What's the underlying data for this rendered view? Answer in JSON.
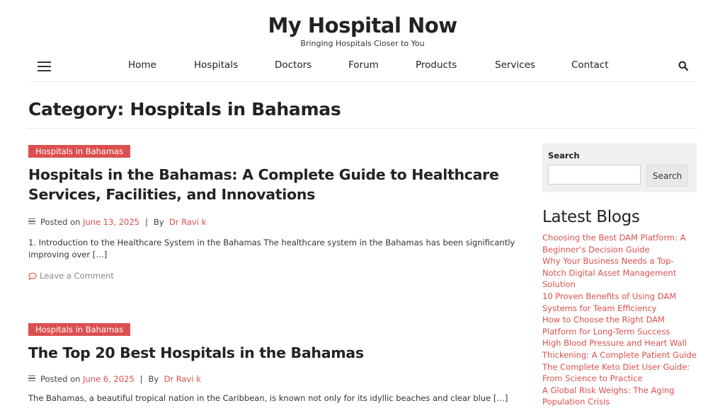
{
  "site": {
    "title": "My Hospital Now",
    "tagline": "Bringing Hospitals Closer to You"
  },
  "nav": {
    "items": [
      "Home",
      "Hospitals",
      "Doctors",
      "Forum",
      "Products",
      "Services",
      "Contact"
    ]
  },
  "page": {
    "title": "Category: Hospitals in Bahamas"
  },
  "posts": [
    {
      "category": "Hospitals in Bahamas",
      "title": "Hospitals in the Bahamas: A Complete Guide to Healthcare Services, Facilities, and Innovations",
      "posted_on": "Posted on",
      "date": "June 13, 2025",
      "by": "By",
      "author": "Dr Ravi k",
      "excerpt": "1. Introduction to the Healthcare System in the Bahamas The healthcare system in the Bahamas has been significantly improving over […]",
      "comment": "Leave a Comment"
    },
    {
      "category": "Hospitals in Bahamas",
      "title": "The Top 20 Best Hospitals in the Bahamas",
      "posted_on": "Posted on",
      "date": "June 6, 2025",
      "by": "By",
      "author": "Dr Ravi k",
      "excerpt": "The Bahamas, a beautiful tropical nation in the Caribbean, is known not only for its idyllic beaches and clear blue […]"
    }
  ],
  "sidebar": {
    "search_label": "Search",
    "search_button": "Search",
    "latest_title": "Latest Blogs",
    "blogs": [
      "Choosing the Best DAM Platform: A Beginner’s Decision Guide",
      "Why Your Business Needs a Top-Notch Digital Asset Management Solution",
      "10 Proven Benefits of Using DAM Systems for Team Efficiency",
      "How to Choose the Right DAM Platform for Long-Term Success",
      "High Blood Pressure and Heart Wall Thickening: A Complete Patient Guide",
      "The Complete Keto Diet User Guide: From Science to Practice",
      "A Global Risk Weighs: The Aging Population Crisis"
    ]
  },
  "colors": {
    "accent": "#dc4f4f",
    "text": "#222222",
    "widget_bg": "#f0f0f0"
  },
  "icons": [
    "menu-icon",
    "search-icon",
    "meta-lines-icon",
    "comment-icon"
  ]
}
